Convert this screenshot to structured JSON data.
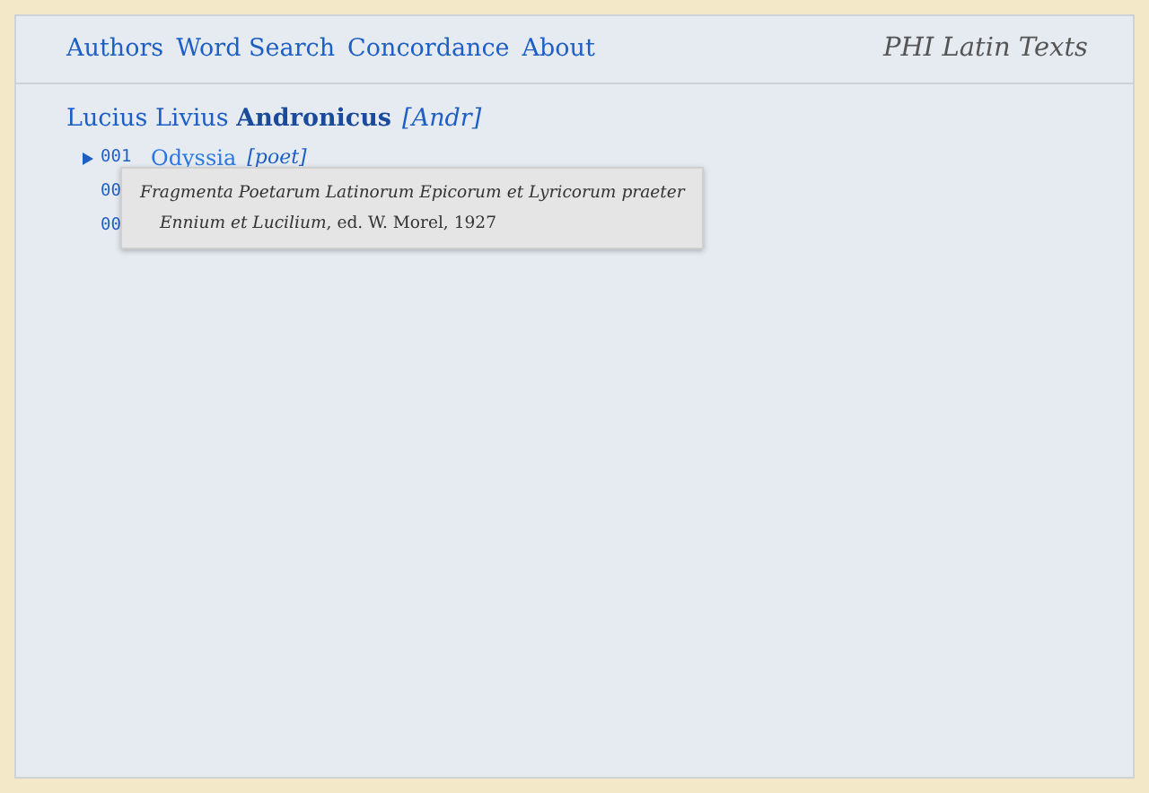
{
  "nav": [
    "Authors",
    "Word Search",
    "Concordance",
    "About"
  ],
  "site_title": "PHI Latin Texts",
  "author": {
    "name": "Lucius Livius",
    "surname": "Andronicus",
    "abbreviation": "[Andr]"
  },
  "works": [
    {
      "number": "001",
      "title": "Odyssia",
      "genre": "[poet]",
      "marked": true
    },
    {
      "number": "00",
      "marked": false
    },
    {
      "number": "00",
      "marked": false
    }
  ],
  "tooltip": {
    "text": "*Fragmenta Poetarum Latinorum Epicorum et Lyricorum praeter Ennium et Lucilium*, ed. W. Morel, 1927"
  }
}
